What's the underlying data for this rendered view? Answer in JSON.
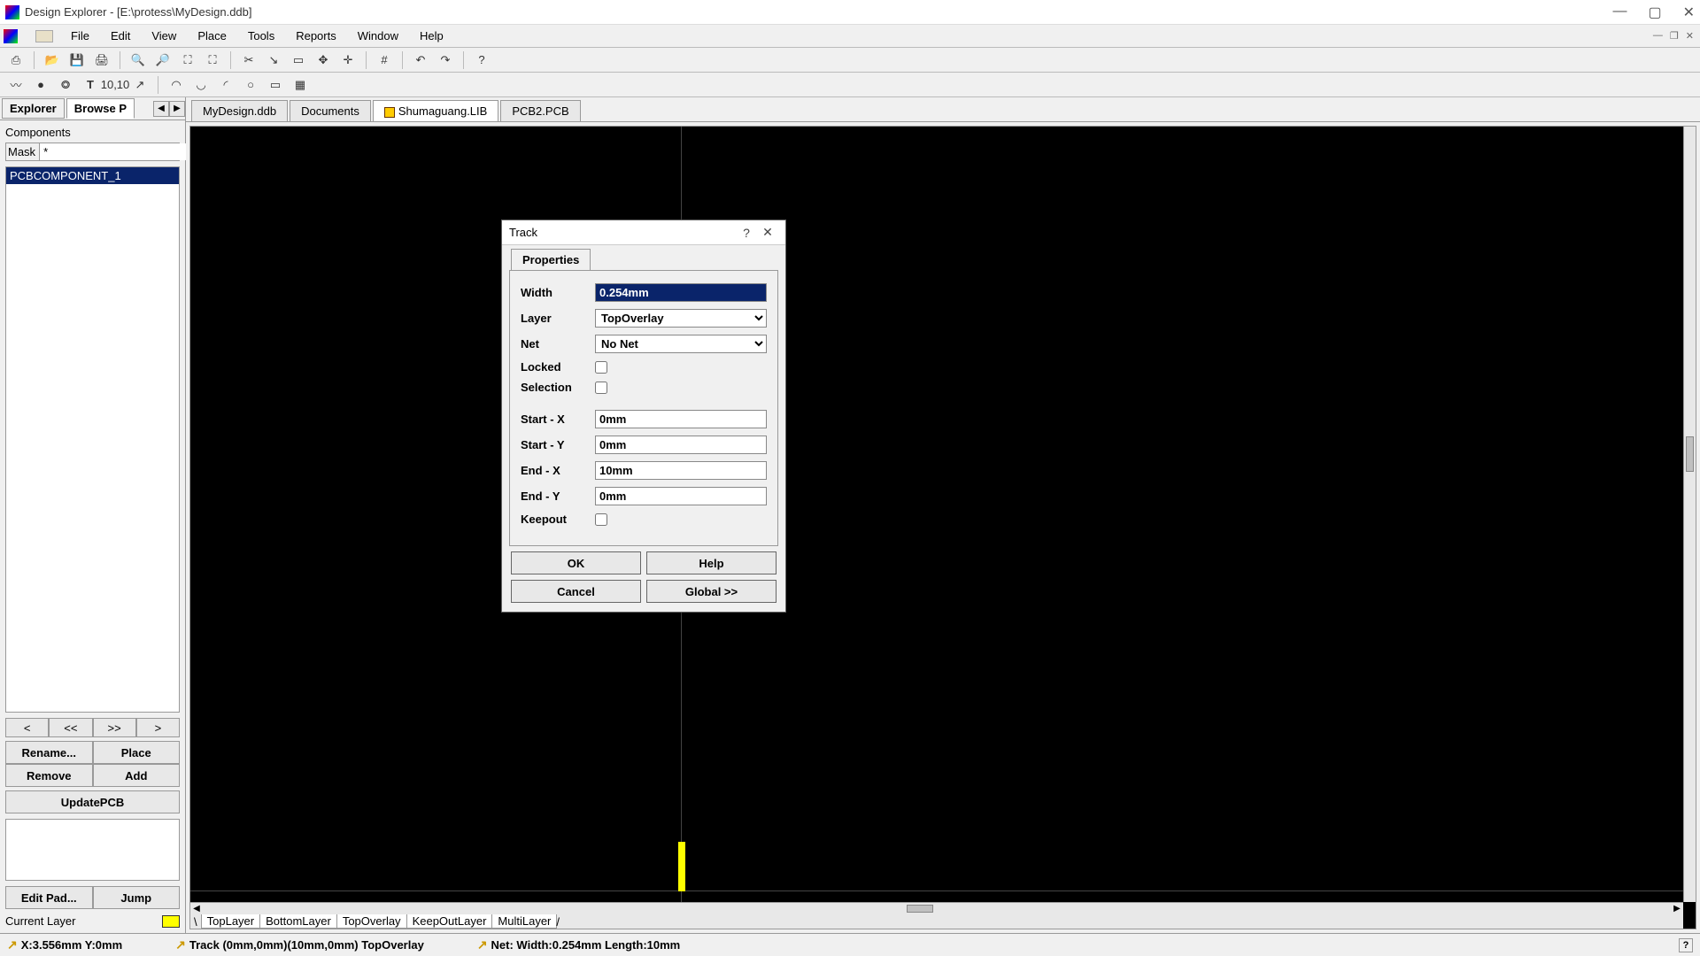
{
  "window": {
    "title": "Design Explorer - [E:\\protess\\MyDesign.ddb]"
  },
  "menu": [
    "File",
    "Edit",
    "View",
    "Place",
    "Tools",
    "Reports",
    "Window",
    "Help"
  ],
  "sidebar": {
    "tabs": {
      "explorer": "Explorer",
      "browse": "Browse P"
    },
    "components_label": "Components",
    "mask_label": "Mask",
    "mask_value": "*",
    "list": [
      "PCBCOMPONENT_1"
    ],
    "nav": {
      "prev": "<",
      "fast_prev": "<<",
      "fast_next": ">>",
      "next": ">"
    },
    "buttons": {
      "rename": "Rename...",
      "place": "Place",
      "remove": "Remove",
      "add": "Add",
      "updatepcb": "UpdatePCB",
      "editpad": "Edit Pad...",
      "jump": "Jump"
    },
    "current_layer_label": "Current Layer"
  },
  "doc_tabs": [
    "MyDesign.ddb",
    "Documents",
    "Shumaguang.LIB",
    "PCB2.PCB"
  ],
  "layer_tabs": [
    "TopLayer",
    "BottomLayer",
    "TopOverlay",
    "KeepOutLayer",
    "MultiLayer"
  ],
  "dialog": {
    "title": "Track",
    "tab": "Properties",
    "fields": {
      "width_label": "Width",
      "width_value": "0.254mm",
      "layer_label": "Layer",
      "layer_value": "TopOverlay",
      "net_label": "Net",
      "net_value": "No Net",
      "locked_label": "Locked",
      "selection_label": "Selection",
      "startx_label": "Start - X",
      "startx_value": "0mm",
      "starty_label": "Start - Y",
      "starty_value": "0mm",
      "endx_label": "End - X",
      "endx_value": "10mm",
      "endy_label": "End - Y",
      "endy_value": "0mm",
      "keepout_label": "Keepout"
    },
    "buttons": {
      "ok": "OK",
      "help": "Help",
      "cancel": "Cancel",
      "global": "Global >>"
    }
  },
  "status": {
    "coords": "X:3.556mm Y:0mm",
    "track": "Track (0mm,0mm)(10mm,0mm)  TopOverlay",
    "net": "Net: Width:0.254mm Length:10mm"
  }
}
